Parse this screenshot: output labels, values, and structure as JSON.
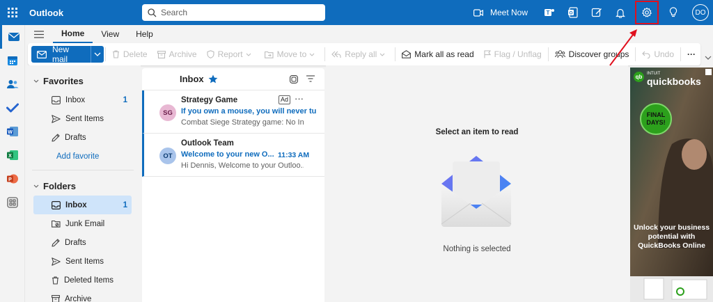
{
  "app": {
    "title": "Outlook"
  },
  "search": {
    "placeholder": "Search"
  },
  "topbar": {
    "meet_now": "Meet Now",
    "avatar_initials": "DO"
  },
  "tabs": [
    {
      "label": "Home"
    },
    {
      "label": "View"
    },
    {
      "label": "Help"
    }
  ],
  "toolbar": {
    "new_mail": "New mail",
    "delete": "Delete",
    "archive": "Archive",
    "report": "Report",
    "move_to": "Move to",
    "reply_all": "Reply all",
    "mark_all_read": "Mark all as read",
    "flag": "Flag / Unflag",
    "discover_groups": "Discover groups",
    "undo": "Undo",
    "more": "···"
  },
  "favorites": {
    "header": "Favorites",
    "items": [
      {
        "label": "Inbox",
        "count": "1"
      },
      {
        "label": "Sent Items",
        "count": ""
      },
      {
        "label": "Drafts",
        "count": ""
      }
    ],
    "add_favorite": "Add favorite"
  },
  "folders": {
    "header": "Folders",
    "items": [
      {
        "label": "Inbox",
        "count": "1"
      },
      {
        "label": "Junk Email",
        "count": ""
      },
      {
        "label": "Drafts",
        "count": ""
      },
      {
        "label": "Sent Items",
        "count": ""
      },
      {
        "label": "Deleted Items",
        "count": ""
      },
      {
        "label": "Archive",
        "count": ""
      }
    ]
  },
  "message_list": {
    "title": "Inbox",
    "messages": [
      {
        "initials": "SG",
        "sender": "Strategy Game",
        "badge": "Ad",
        "more": "···",
        "subject": "If you own a mouse, you will never turn",
        "preview": "Combat Siege Strategy game: No Insta...",
        "time": "",
        "avatar_color": "#e8b8d3"
      },
      {
        "initials": "OT",
        "sender": "Outlook Team",
        "badge": "",
        "more": "",
        "subject": "Welcome to your new O...",
        "preview": "Hi Dennis, Welcome to your Outloo...",
        "time": "11:33 AM",
        "avatar_color": "#a9c4eb"
      }
    ]
  },
  "reading_pane": {
    "prompt": "Select an item to read",
    "empty": "Nothing is selected"
  },
  "ad": {
    "brand_small": "INTUIT",
    "brand": "quickbooks",
    "logo_mark": "qb",
    "badge": "FINAL DAYS!",
    "text": "Unlock your business potential with QuickBooks Online"
  },
  "colors": {
    "brand_blue": "#0f6cbd",
    "highlight_red": "#e0101e",
    "selected_bg": "#cfe4fa"
  }
}
